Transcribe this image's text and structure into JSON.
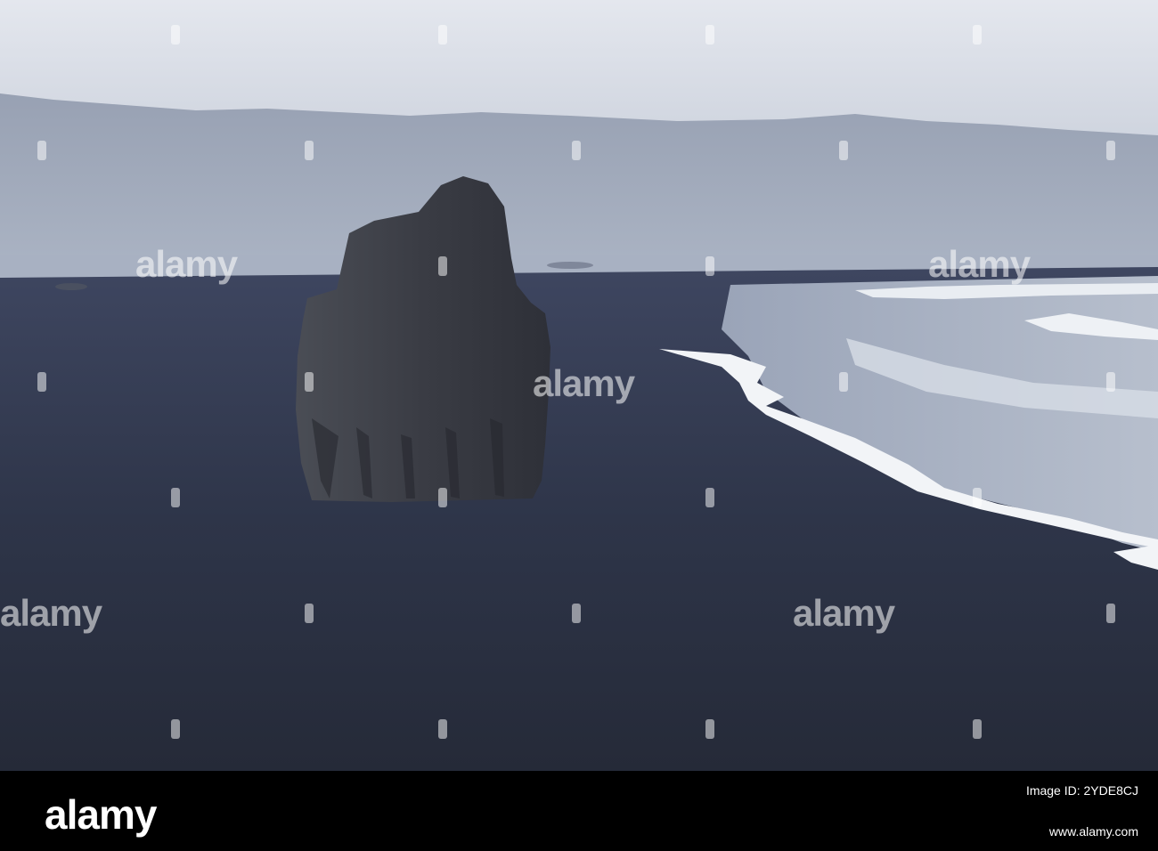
{
  "watermark": {
    "brand": "alamy"
  },
  "footer": {
    "logo": "alamy",
    "image_id": "Image ID: 2YDE8CJ",
    "url": "www.alamy.com"
  },
  "colors": {
    "sky": "#d9dde6",
    "mountains": "#9ea7b8",
    "sand": "#2b3245",
    "surf": "#f2f4f7",
    "rock": "#3a3d46",
    "footer_bg": "#000000"
  }
}
